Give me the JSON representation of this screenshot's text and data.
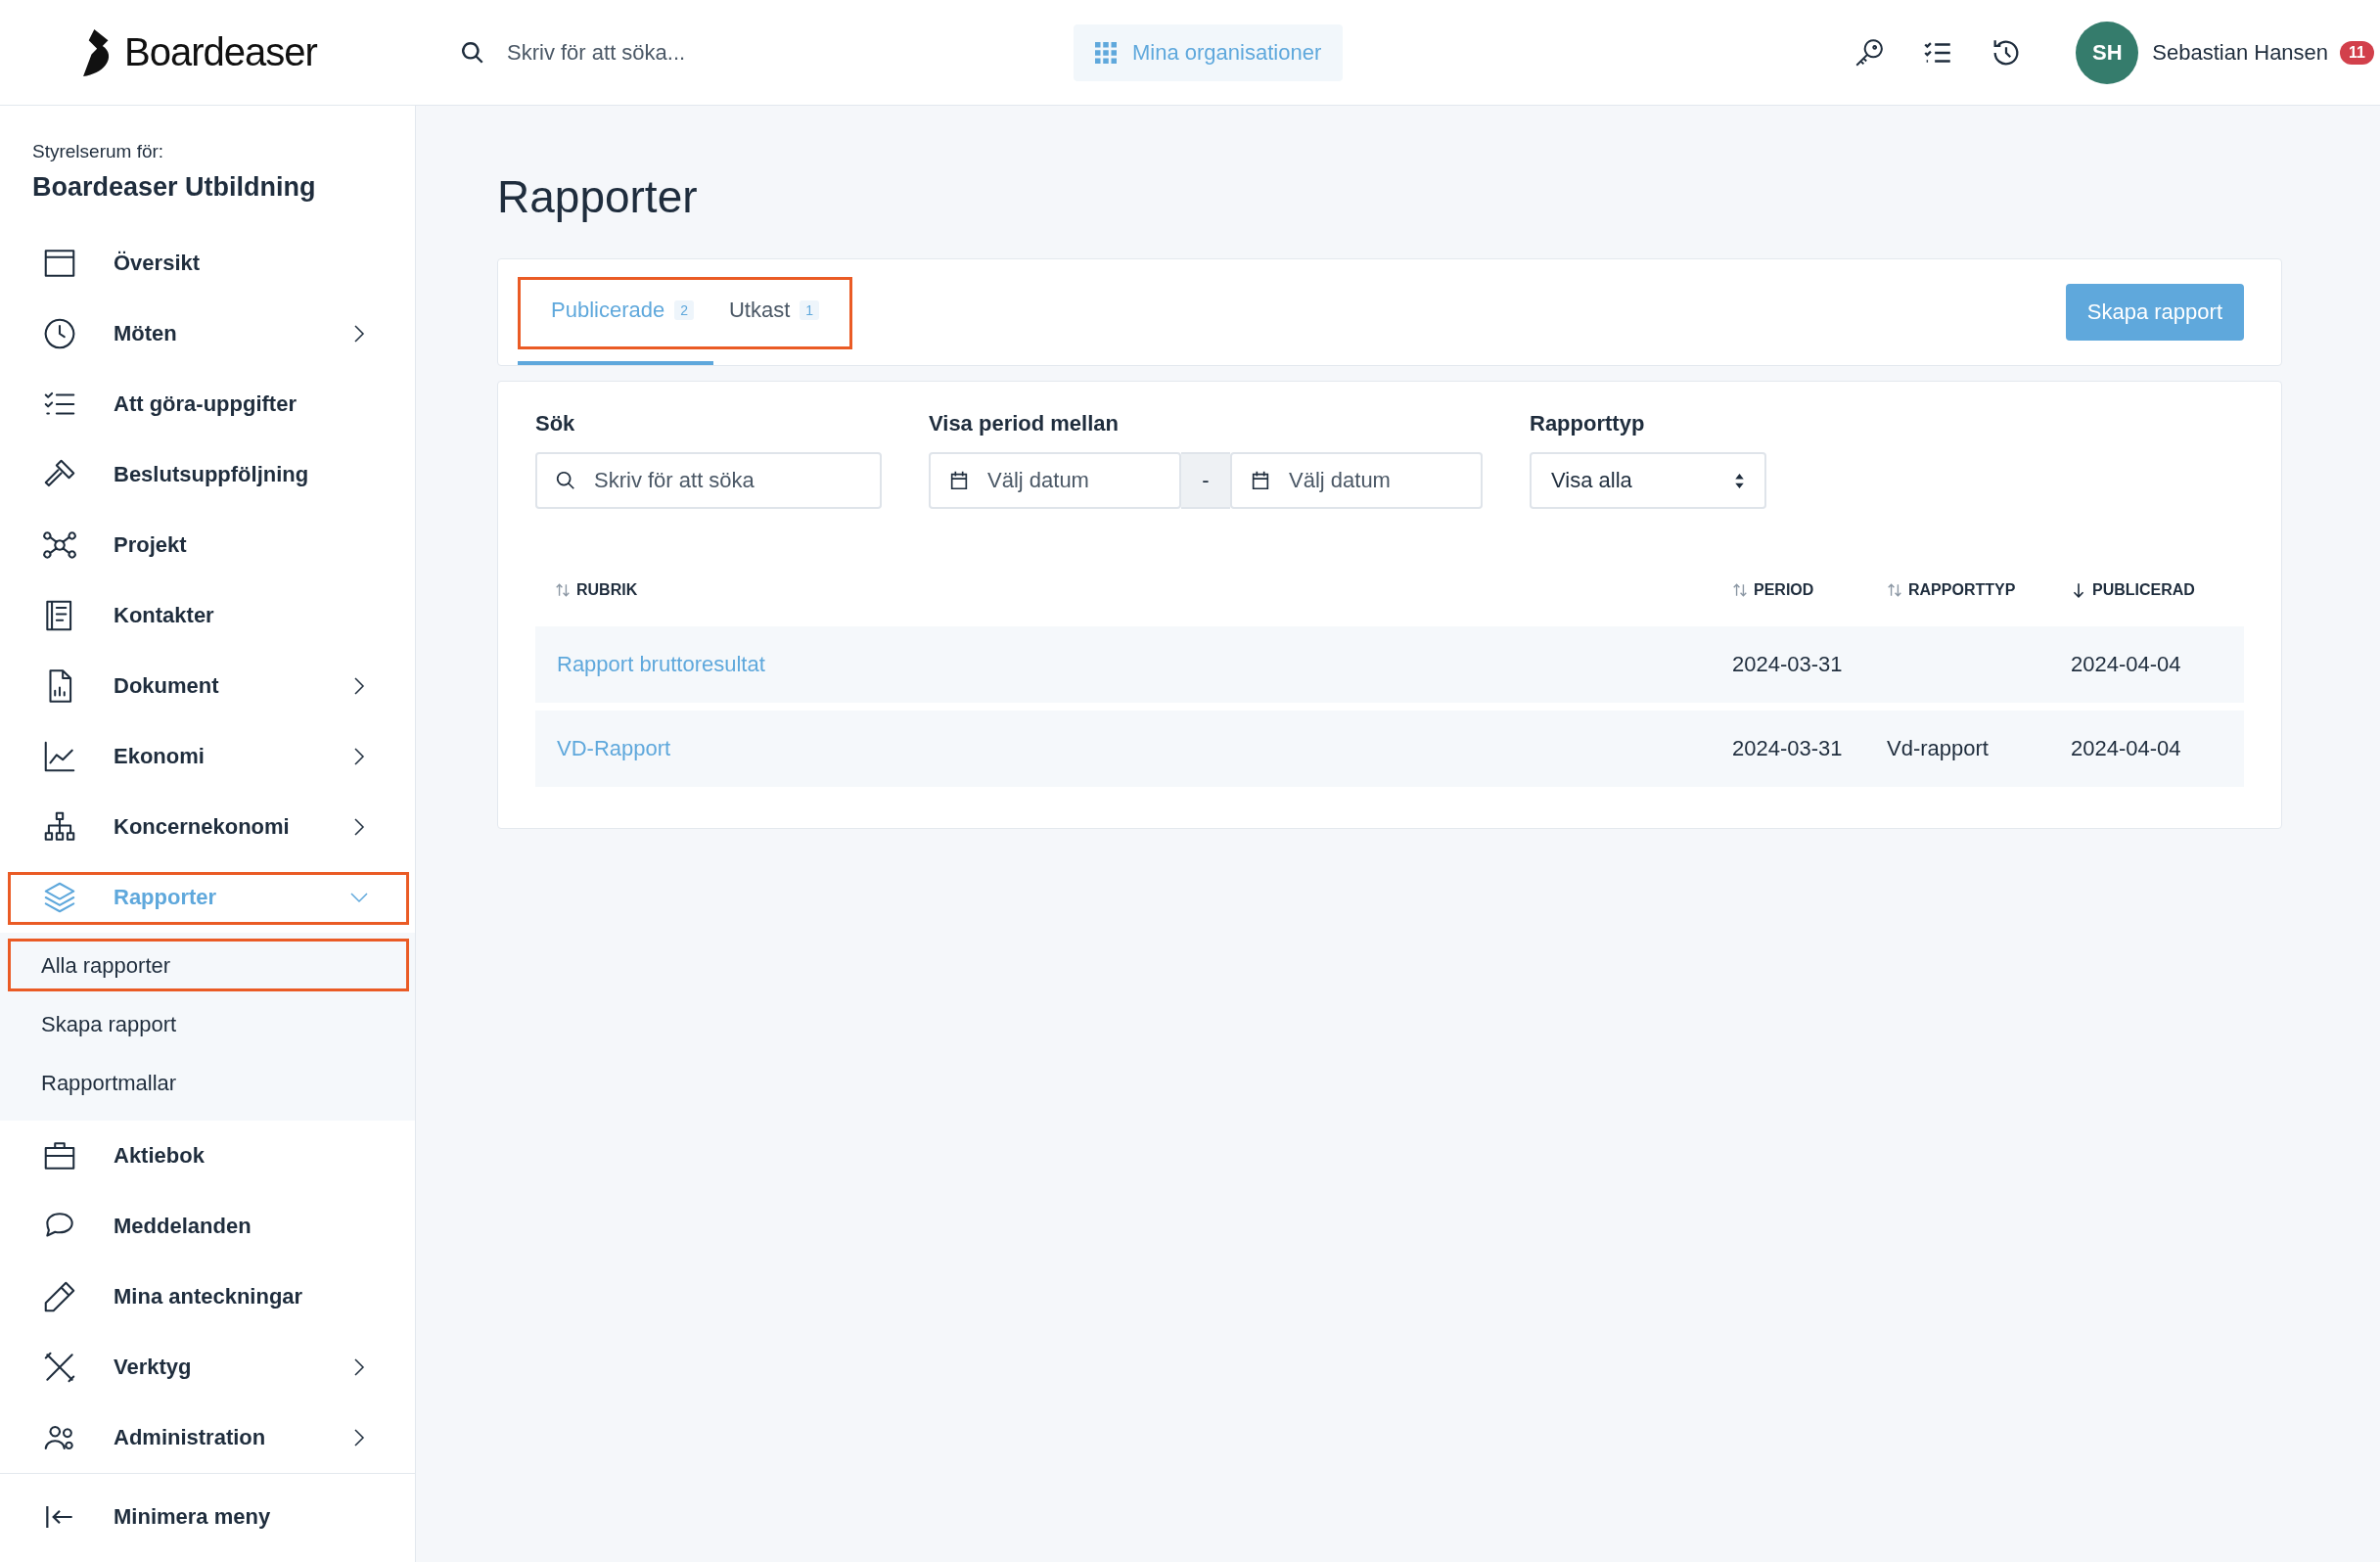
{
  "header": {
    "logo": "Boardeaser",
    "search": {
      "placeholder": "Skriv för att söka..."
    },
    "org_button": "Mina organisationer",
    "user": {
      "initials": "SH",
      "name": "Sebastian Hansen",
      "badge": "11"
    }
  },
  "sidebar": {
    "caption": "Styrelserum för:",
    "org": "Boardeaser Utbildning",
    "items": [
      {
        "label": "Översikt",
        "selected": false,
        "highlighted": false
      },
      {
        "label": "Möten",
        "expanded": false,
        "selected": false,
        "highlighted": false
      },
      {
        "label": "Att göra-uppgifter",
        "selected": false,
        "highlighted": false
      },
      {
        "label": "Beslutsuppföljning",
        "selected": false,
        "highlighted": false
      },
      {
        "label": "Projekt",
        "selected": false,
        "highlighted": false
      },
      {
        "label": "Kontakter",
        "selected": false,
        "highlighted": false
      },
      {
        "label": "Dokument",
        "expanded": false,
        "selected": false,
        "highlighted": false
      },
      {
        "label": "Ekonomi",
        "expanded": false,
        "selected": false,
        "highlighted": false
      },
      {
        "label": "Koncernekonomi",
        "expanded": false,
        "selected": false,
        "highlighted": false
      },
      {
        "label": "Rapporter",
        "expanded": true,
        "selected": true,
        "highlighted": true,
        "children": [
          {
            "label": "Alla rapporter",
            "highlighted": true
          },
          {
            "label": "Skapa rapport",
            "highlighted": false
          },
          {
            "label": "Rapportmallar",
            "highlighted": false
          }
        ]
      },
      {
        "label": "Aktiebok",
        "selected": false,
        "highlighted": false
      },
      {
        "label": "Meddelanden",
        "selected": false,
        "highlighted": false
      },
      {
        "label": "Mina anteckningar",
        "selected": false,
        "highlighted": false
      },
      {
        "label": "Verktyg",
        "expanded": false,
        "selected": false,
        "highlighted": false
      },
      {
        "label": "Administration",
        "expanded": false,
        "selected": false,
        "highlighted": false
      }
    ],
    "collapse": "Minimera meny"
  },
  "main": {
    "title": "Rapporter",
    "tabs_highlighted": true,
    "tabs": [
      {
        "label": "Publicerade",
        "count": "2",
        "selected": true
      },
      {
        "label": "Utkast",
        "count": "1",
        "selected": false
      }
    ],
    "create_button": "Skapa rapport",
    "filters": {
      "search": {
        "label": "Sök",
        "placeholder": "Skriv för att söka"
      },
      "period": {
        "label": "Visa period mellan",
        "from_placeholder": "Välj datum",
        "separator": "-",
        "to_placeholder": "Välj datum"
      },
      "type": {
        "label": "Rapporttyp",
        "value": "Visa alla"
      }
    },
    "table": {
      "columns": [
        {
          "label": "RUBRIK",
          "sorted": false
        },
        {
          "label": "PERIOD",
          "sorted": false
        },
        {
          "label": "RAPPORTTYP",
          "sorted": false
        },
        {
          "label": "PUBLICERAD",
          "sorted": true
        }
      ],
      "rows": [
        {
          "cells": [
            "Rapport bruttoresultat",
            "2024-03-31",
            "",
            "2024-04-04"
          ]
        },
        {
          "cells": [
            "VD-Rapport",
            "2024-03-31",
            "Vd-rapport",
            "2024-04-04"
          ]
        }
      ]
    }
  }
}
